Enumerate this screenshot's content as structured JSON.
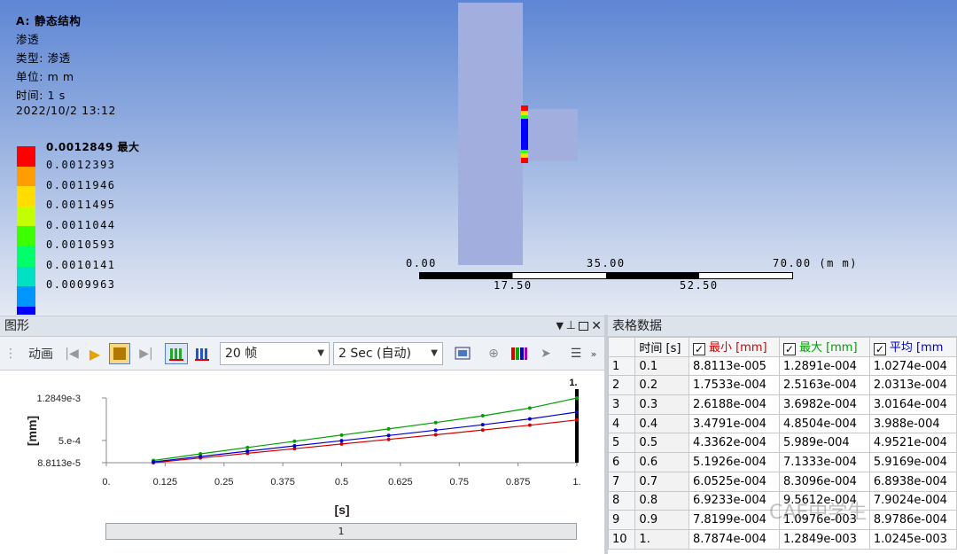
{
  "viewport": {
    "info_lines": [
      "A: 静态结构",
      "渗透",
      "类型: 渗透",
      "单位: m m",
      "时间: 1  s",
      "2022/10/2 13:12"
    ],
    "legend_max": "0.0012849 最大",
    "legend_values": [
      "0.0012393",
      "0.0011946",
      "0.0011495",
      "0.0011044",
      "0.0010593",
      "0.0010141",
      "0.0009963"
    ],
    "legend_colors": [
      "#ff0000",
      "#ff9c00",
      "#ffdd00",
      "#c4ff00",
      "#3cff00",
      "#00ff6a",
      "#00e0c4",
      "#0096ff",
      "#0000ff"
    ],
    "scale": {
      "l0": "0.00",
      "l35": "35.00",
      "l70": "70.00 (m m)",
      "l175": "17.50",
      "l525": "52.50"
    }
  },
  "graph_panel": {
    "title": "图形",
    "animation_label": "动画",
    "frames_select": "20 帧",
    "duration_select": "2 Sec (自动)",
    "slider_value": "1"
  },
  "table_panel": {
    "title": "表格数据",
    "headers": {
      "time": "时间 [s]",
      "min": "最小 [mm]",
      "max": "最大 [mm]",
      "avg": "平均 [mm"
    },
    "header_colors": {
      "min": "#d40000",
      "max": "#00a000",
      "avg": "#0000d0"
    },
    "rows": [
      {
        "idx": "1",
        "time": "0.1",
        "min": "8.8113e-005",
        "max": "1.2891e-004",
        "avg": "1.0274e-004"
      },
      {
        "idx": "2",
        "time": "0.2",
        "min": "1.7533e-004",
        "max": "2.5163e-004",
        "avg": "2.0313e-004"
      },
      {
        "idx": "3",
        "time": "0.3",
        "min": "2.6188e-004",
        "max": "3.6982e-004",
        "avg": "3.0164e-004"
      },
      {
        "idx": "4",
        "time": "0.4",
        "min": "3.4791e-004",
        "max": "4.8504e-004",
        "avg": "3.988e-004"
      },
      {
        "idx": "5",
        "time": "0.5",
        "min": "4.3362e-004",
        "max": "5.989e-004",
        "avg": "4.9521e-004"
      },
      {
        "idx": "6",
        "time": "0.6",
        "min": "5.1926e-004",
        "max": "7.1333e-004",
        "avg": "5.9169e-004"
      },
      {
        "idx": "7",
        "time": "0.7",
        "min": "6.0525e-004",
        "max": "8.3096e-004",
        "avg": "6.8938e-004"
      },
      {
        "idx": "8",
        "time": "0.8",
        "min": "6.9233e-004",
        "max": "9.5612e-004",
        "avg": "7.9024e-004"
      },
      {
        "idx": "9",
        "time": "0.9",
        "min": "7.8199e-004",
        "max": "1.0976e-003",
        "avg": "8.9786e-004"
      },
      {
        "idx": "10",
        "time": "1.",
        "min": "8.7874e-004",
        "max": "1.2849e-003",
        "avg": "1.0245e-003"
      }
    ]
  },
  "chart_data": {
    "type": "line",
    "xlabel": "[s]",
    "ylabel": "[mm]",
    "xlim": [
      0,
      1
    ],
    "ylim": [
      8.8113e-05,
      0.0012849
    ],
    "x_ticks": [
      "0.",
      "0.125",
      "0.25",
      "0.375",
      "0.5",
      "0.625",
      "0.75",
      "0.875",
      "1."
    ],
    "y_ticks": [
      "8.8113e-5",
      "5.e-4",
      "1.2849e-3"
    ],
    "cursor_label": "1.",
    "x": [
      0.1,
      0.2,
      0.3,
      0.4,
      0.5,
      0.6,
      0.7,
      0.8,
      0.9,
      1.0
    ],
    "series": [
      {
        "color": "#d40000",
        "values": [
          8.8113e-05,
          0.00017533,
          0.00026188,
          0.00034791,
          0.00043362,
          0.00051926,
          0.00060525,
          0.00069233,
          0.00078199,
          0.00087874
        ]
      },
      {
        "color": "#00a000",
        "values": [
          0.00012891,
          0.00025163,
          0.00036982,
          0.00048504,
          0.0005989,
          0.00071333,
          0.00083096,
          0.00095612,
          0.0010976,
          0.0012849
        ]
      },
      {
        "color": "#0000d0",
        "values": [
          0.00010274,
          0.00020313,
          0.00030164,
          0.0003988,
          0.00049521,
          0.00059169,
          0.00068938,
          0.00079024,
          0.00089786,
          0.0010245
        ]
      }
    ]
  },
  "watermark": "CAE中学生"
}
